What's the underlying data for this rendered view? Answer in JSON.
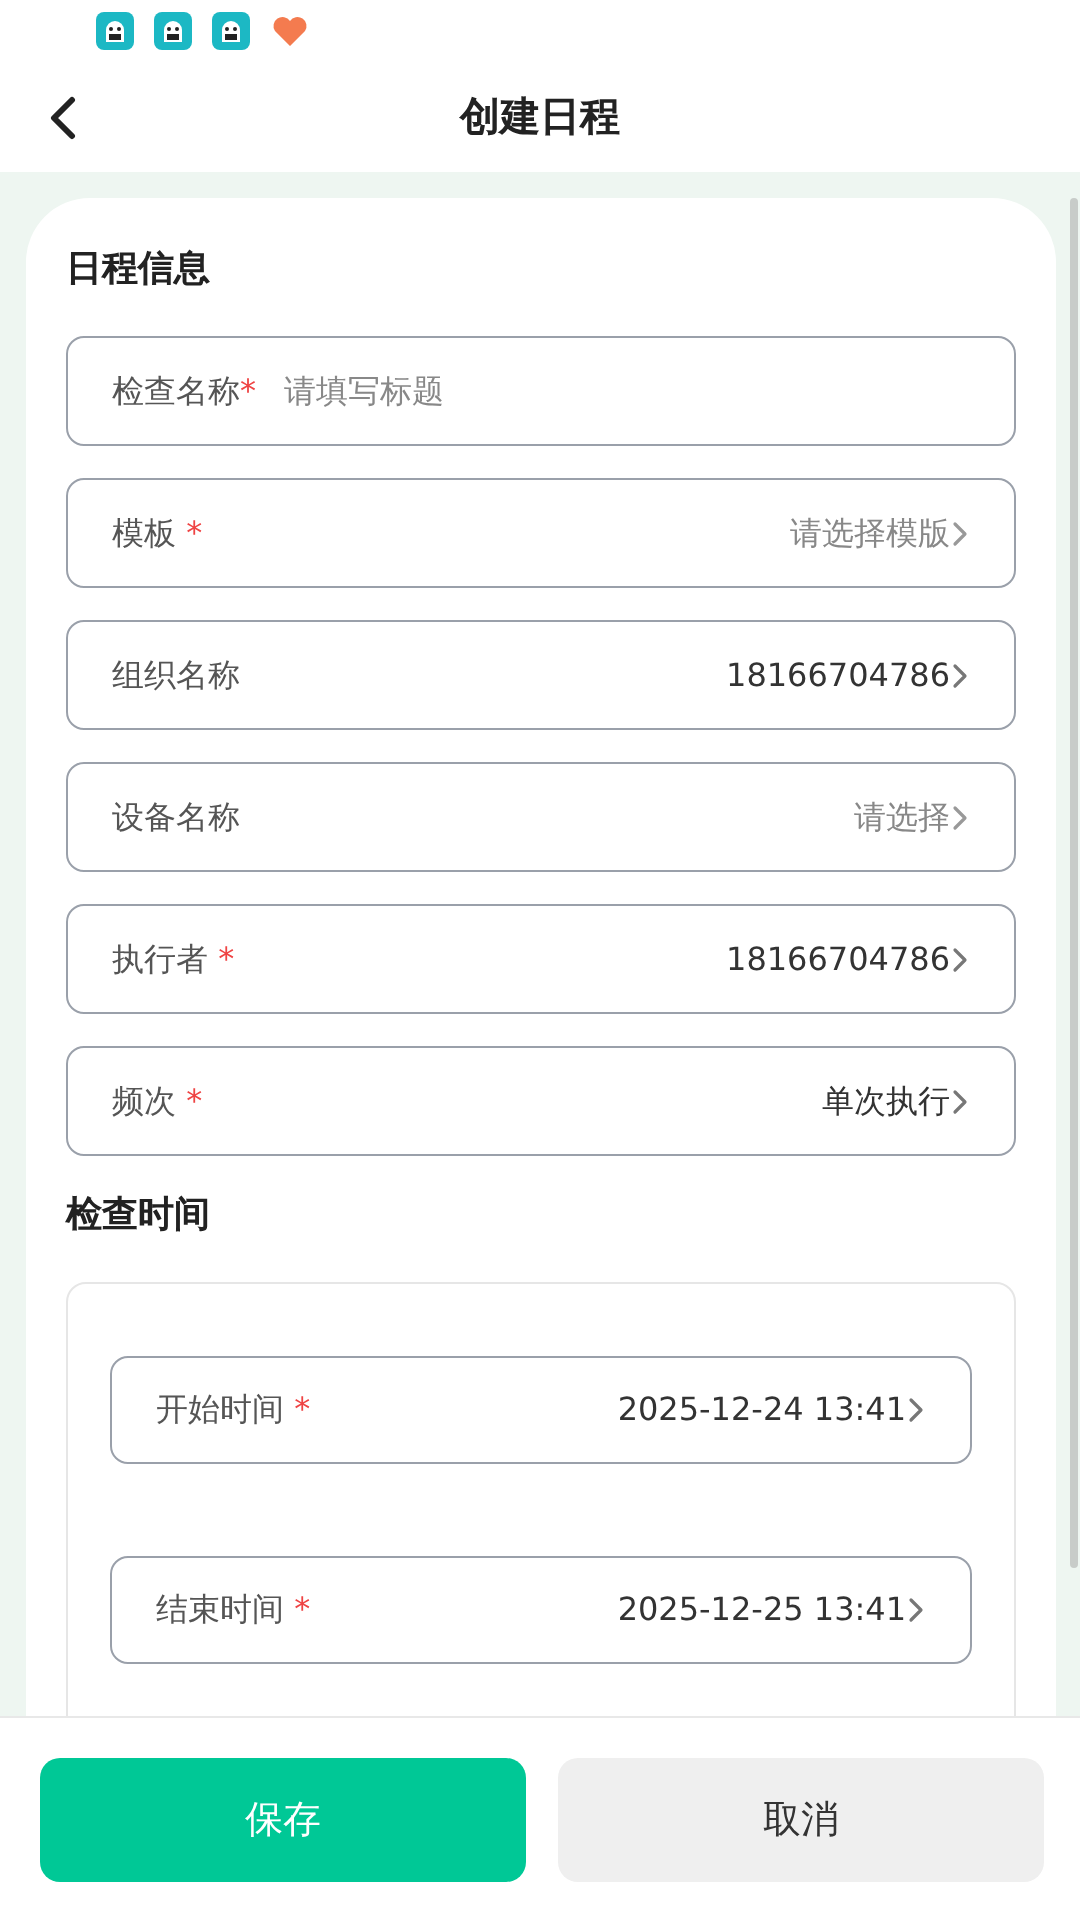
{
  "status_bar": {
    "notification_icons": [
      {
        "kind": "app"
      },
      {
        "kind": "app"
      },
      {
        "kind": "app"
      },
      {
        "kind": "heart"
      }
    ]
  },
  "header": {
    "title": "创建日程"
  },
  "sections": [
    {
      "title": "日程信息",
      "kind": "plain",
      "fields": [
        {
          "kind": "input",
          "label": "检查名称",
          "required_mark": "*",
          "placeholder": "请填写标题"
        },
        {
          "kind": "select",
          "label": "模板",
          "required_mark": "*",
          "placeholder": "请选择模版"
        },
        {
          "kind": "select",
          "label": "组织名称",
          "value": "18166704786"
        },
        {
          "kind": "select",
          "label": "设备名称",
          "placeholder": "请选择"
        },
        {
          "kind": "select",
          "label": "执行者",
          "required_mark": "*",
          "value": "18166704786"
        },
        {
          "kind": "select",
          "label": "频次",
          "required_mark": "*",
          "value": "单次执行"
        }
      ]
    },
    {
      "title": "检查时间",
      "kind": "panel",
      "fields": [
        {
          "kind": "select",
          "label": "开始时间",
          "required_mark": "*",
          "value": "2025-12-24 13:41"
        },
        {
          "kind": "select",
          "label": "结束时间",
          "required_mark": "*",
          "value": "2025-12-25 13:41"
        }
      ]
    }
  ],
  "buttons": [
    {
      "kind": "primary",
      "label": "保存"
    },
    {
      "kind": "secondary",
      "label": "取消"
    }
  ]
}
